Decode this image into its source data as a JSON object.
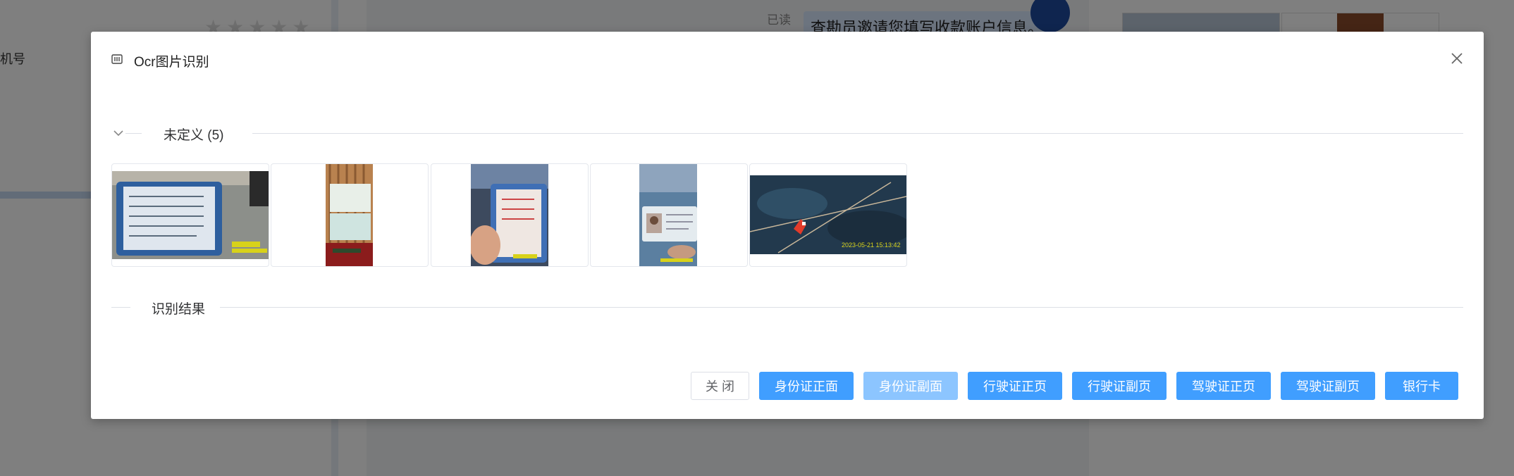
{
  "background": {
    "left_label": "机号",
    "read_status": "已读",
    "message_preview": "查勘员邀请您填写收款账户信息。"
  },
  "dialog": {
    "title": "Ocr图片识别",
    "close_icon": "close-icon",
    "title_icon": "ocr-scan-icon"
  },
  "sections": {
    "undefined_label": "未定义 (5)",
    "result_label": "识别结果"
  },
  "thumbnails": [
    {
      "name": "thumb-vehicle-license-card",
      "desc_color": "#2e5f9e"
    },
    {
      "name": "thumb-bank-card-document",
      "desc_color": "#b9824f"
    },
    {
      "name": "thumb-driving-license-held",
      "desc_color": "#3f6fb5"
    },
    {
      "name": "thumb-id-card-photo",
      "desc_color": "#5b7fa0"
    },
    {
      "name": "thumb-scene-photo",
      "desc_color": "#22394d",
      "caption": "2023-05-21 15:13:42"
    }
  ],
  "buttons": {
    "close": "关 闭",
    "id_front": "身份证正面",
    "id_back": "身份证副面",
    "vehicle_license_front": "行驶证正页",
    "vehicle_license_back": "行驶证副页",
    "driver_license_front": "驾驶证正页",
    "driver_license_back": "驾驶证副页",
    "bank_card": "银行卡"
  },
  "colors": {
    "primary": "#409eff",
    "primary_light": "#8cc5ff",
    "border": "#dcdfe6"
  }
}
